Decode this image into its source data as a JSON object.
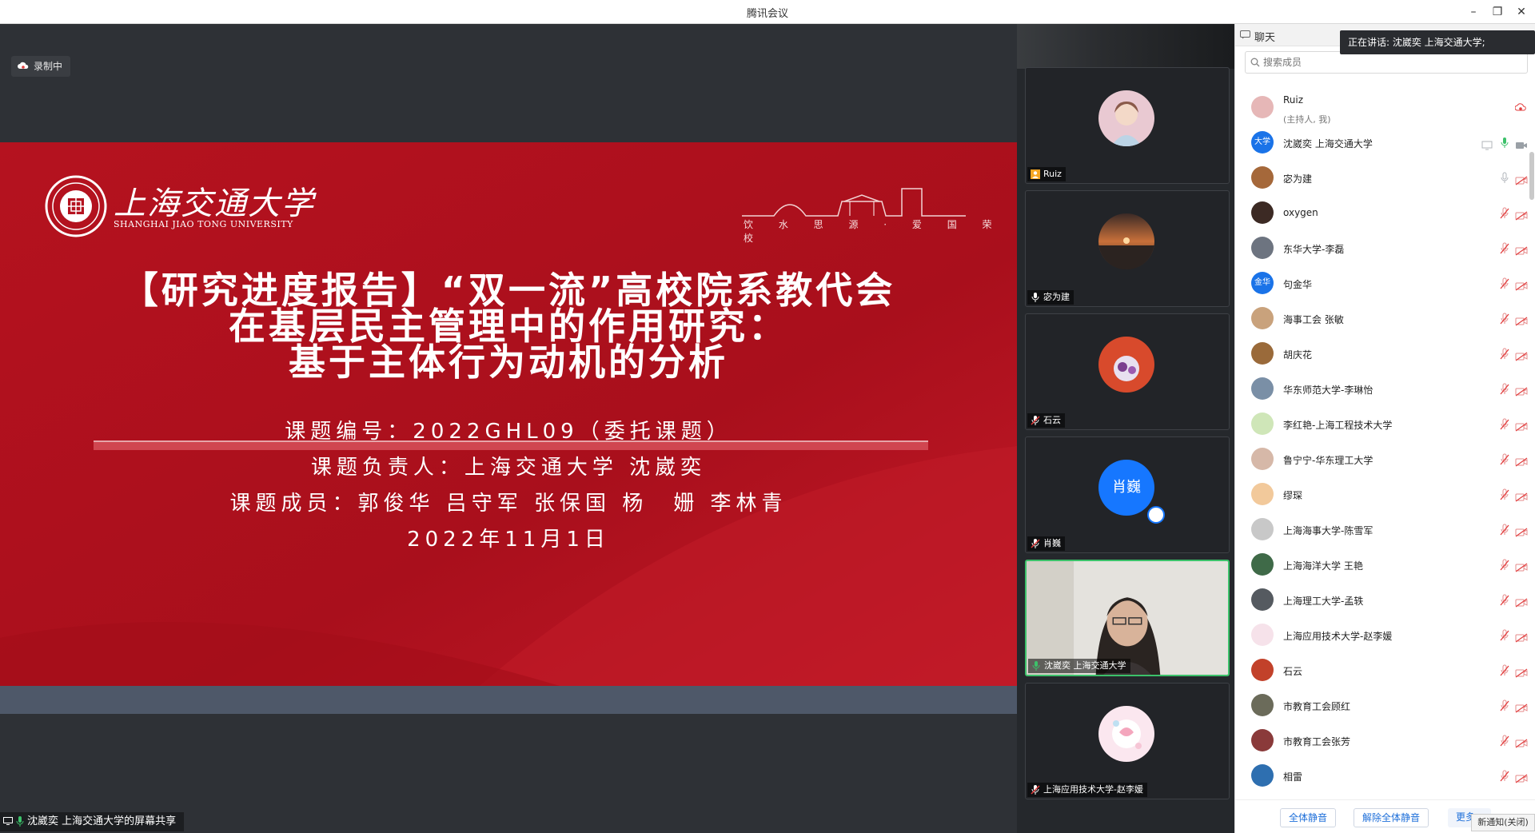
{
  "window": {
    "title": "腾讯会议"
  },
  "recording": {
    "label": "录制中"
  },
  "slide": {
    "university_cn": "上海交通大学",
    "university_en": "SHANGHAI JIAO TONG UNIVERSITY",
    "motto": "饮 水 思 源 · 爱 国 荣 校",
    "title_line1": "【研究进度报告】“双一流”高校院系教代会",
    "title_line2": "在基层民主管理中的作用研究：",
    "title_line3": "基于主体行为动机的分析",
    "project_no": "课题编号：2022GHL09（委托课题）",
    "leader": "课题负责人：上海交通大学 沈崴奕",
    "members": "课题成员：郭俊华 吕守军 张保国 杨　姗 李林青",
    "date": "2022年11月1日"
  },
  "share_status": {
    "label": "沈崴奕 上海交通大学的屏幕共享"
  },
  "speaking": {
    "label": "正在讲话: 沈崴奕 上海交通大学;"
  },
  "video_tiles": [
    {
      "name": "Ruiz"
    },
    {
      "name": "宓为建"
    },
    {
      "name": "石云"
    },
    {
      "name": "肖巍",
      "avatar_text": "肖巍"
    },
    {
      "name": "沈崴奕 上海交通大学"
    },
    {
      "name": "上海应用技术大学-赵李媛"
    }
  ],
  "panel": {
    "header": "聊天",
    "search_placeholder": "搜索成员",
    "members": [
      {
        "name": "Ruiz",
        "sub": "(主持人, 我)",
        "avatar_color": "#e6b7b7"
      },
      {
        "name": "沈崴奕 上海交通大学",
        "avatar_text": "大学",
        "avatar_color": "#1a73e8"
      },
      {
        "name": "宓为建",
        "avatar_color": "#a5683a"
      },
      {
        "name": "oxygen",
        "avatar_color": "#3c2a24"
      },
      {
        "name": "东华大学-李磊",
        "avatar_color": "#6d7480"
      },
      {
        "name": "句金华",
        "avatar_text": "金华",
        "avatar_color": "#1a73e8"
      },
      {
        "name": "海事工会 张敏",
        "avatar_color": "#c9a27c"
      },
      {
        "name": "胡庆花",
        "avatar_color": "#9a6a3a"
      },
      {
        "name": "华东师范大学-李琳怡",
        "avatar_color": "#7a8fa6"
      },
      {
        "name": "李红艳-上海工程技术大学",
        "avatar_color": "#cfe6b8"
      },
      {
        "name": "鲁宁宁-华东理工大学",
        "avatar_color": "#d6b8a8"
      },
      {
        "name": "缪琛",
        "avatar_color": "#f2c99b"
      },
      {
        "name": "上海海事大学-陈雪军",
        "avatar_color": "#c8c8c8"
      },
      {
        "name": "上海海洋大学 王艳",
        "avatar_color": "#3f6a48"
      },
      {
        "name": "上海理工大学-孟轶",
        "avatar_color": "#555a60"
      },
      {
        "name": "上海应用技术大学-赵李媛",
        "avatar_color": "#f6e2ea"
      },
      {
        "name": "石云",
        "avatar_color": "#c2412a"
      },
      {
        "name": "市教育工会顾红",
        "avatar_color": "#6b6b5a"
      },
      {
        "name": "市教育工会张芳",
        "avatar_color": "#8a3a3a"
      },
      {
        "name": "相雷",
        "avatar_color": "#2e6fb0"
      }
    ],
    "mute_all": "全体静音",
    "unmute_all": "解除全体静音",
    "more": "更多 ▾"
  },
  "notice": {
    "label": "新通知(关闭)"
  }
}
